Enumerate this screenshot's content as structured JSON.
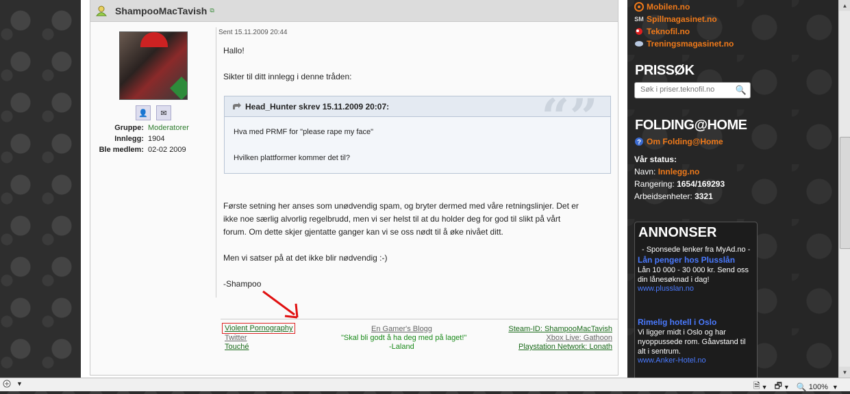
{
  "post": {
    "username": "ShampooMacTavish",
    "sent": "Sent 15.11.2009 20:44",
    "profile": {
      "rows": [
        {
          "key": "Gruppe:",
          "value": "Moderatorer"
        },
        {
          "key": "Innlegg:",
          "value": "1904"
        },
        {
          "key": "Ble medlem:",
          "value": "02-02 2009"
        }
      ]
    },
    "greeting": "Hallo!",
    "intro": "Sikter til ditt innlegg i denne tråden:",
    "quote": {
      "header": "Head_Hunter skrev 15.11.2009 20:07:",
      "line1": "Hva med PRMF for \"please rape my face\"",
      "line2": "Hvilken plattformer kommer det til?"
    },
    "para1": "Første setning her anses som unødvendig spam, og bryter dermed med våre retningslinjer. Det er",
    "para2": "ikke noe særlig alvorlig regelbrudd, men vi ser helst til at du holder deg for god til slikt på vårt",
    "para3": "forum. Om dette skjer gjentatte ganger kan vi se oss nødt til å øke nivået ditt.",
    "para4": "Men vi satser på at det ikke blir nødvendig :-)",
    "signoff": "-Shampoo",
    "signature": {
      "left": [
        "Violent Pornography",
        "Twitter",
        "Touché"
      ],
      "center_link": "En Gamer's Blogg",
      "center_quote": "\"Skal bli godt å ha deg med på laget!\"",
      "center_author": "-Laland",
      "right": [
        "Steam-ID: ShampooMacTavish",
        "Xbox Live: Gathoon",
        "Playstation Network: Lonath"
      ]
    }
  },
  "sidebar": {
    "sites": [
      "Mobilen.no",
      "Spillmagasinet.no",
      "Teknofil.no",
      "Treningsmagasinet.no"
    ],
    "site_icon_spill": "SM",
    "prissok_title": "PRISSØK",
    "search_placeholder": "Søk i priser.teknofil.no",
    "folding_title": "FOLDING@HOME",
    "folding_link": "Om Folding@Home",
    "status_title": "Vår status:",
    "name_label": "Navn:",
    "name_value": "Innlegg.no",
    "rank_label": "Rangering:",
    "rank_value": "1654/169293",
    "units_label": "Arbeidsenheter:",
    "units_value": "3321",
    "ads": {
      "title": "ANNONSER",
      "sponsor": "- Sponsede lenker fra MyAd.no -",
      "items": [
        {
          "title": "Lån penger hos Plusslån",
          "desc": "Lån 10 000 - 30 000 kr. Send oss din lånesøknad i dag!",
          "url": "www.plusslan.no"
        },
        {
          "title": "Rimelig hotell i Oslo",
          "desc": "Vi ligger midt i Oslo og har nyoppussede rom. Gåavstand til alt i sentrum.",
          "url": "www.Anker-Hotel.no"
        }
      ]
    }
  },
  "statusbar": {
    "zoom": "100%"
  }
}
